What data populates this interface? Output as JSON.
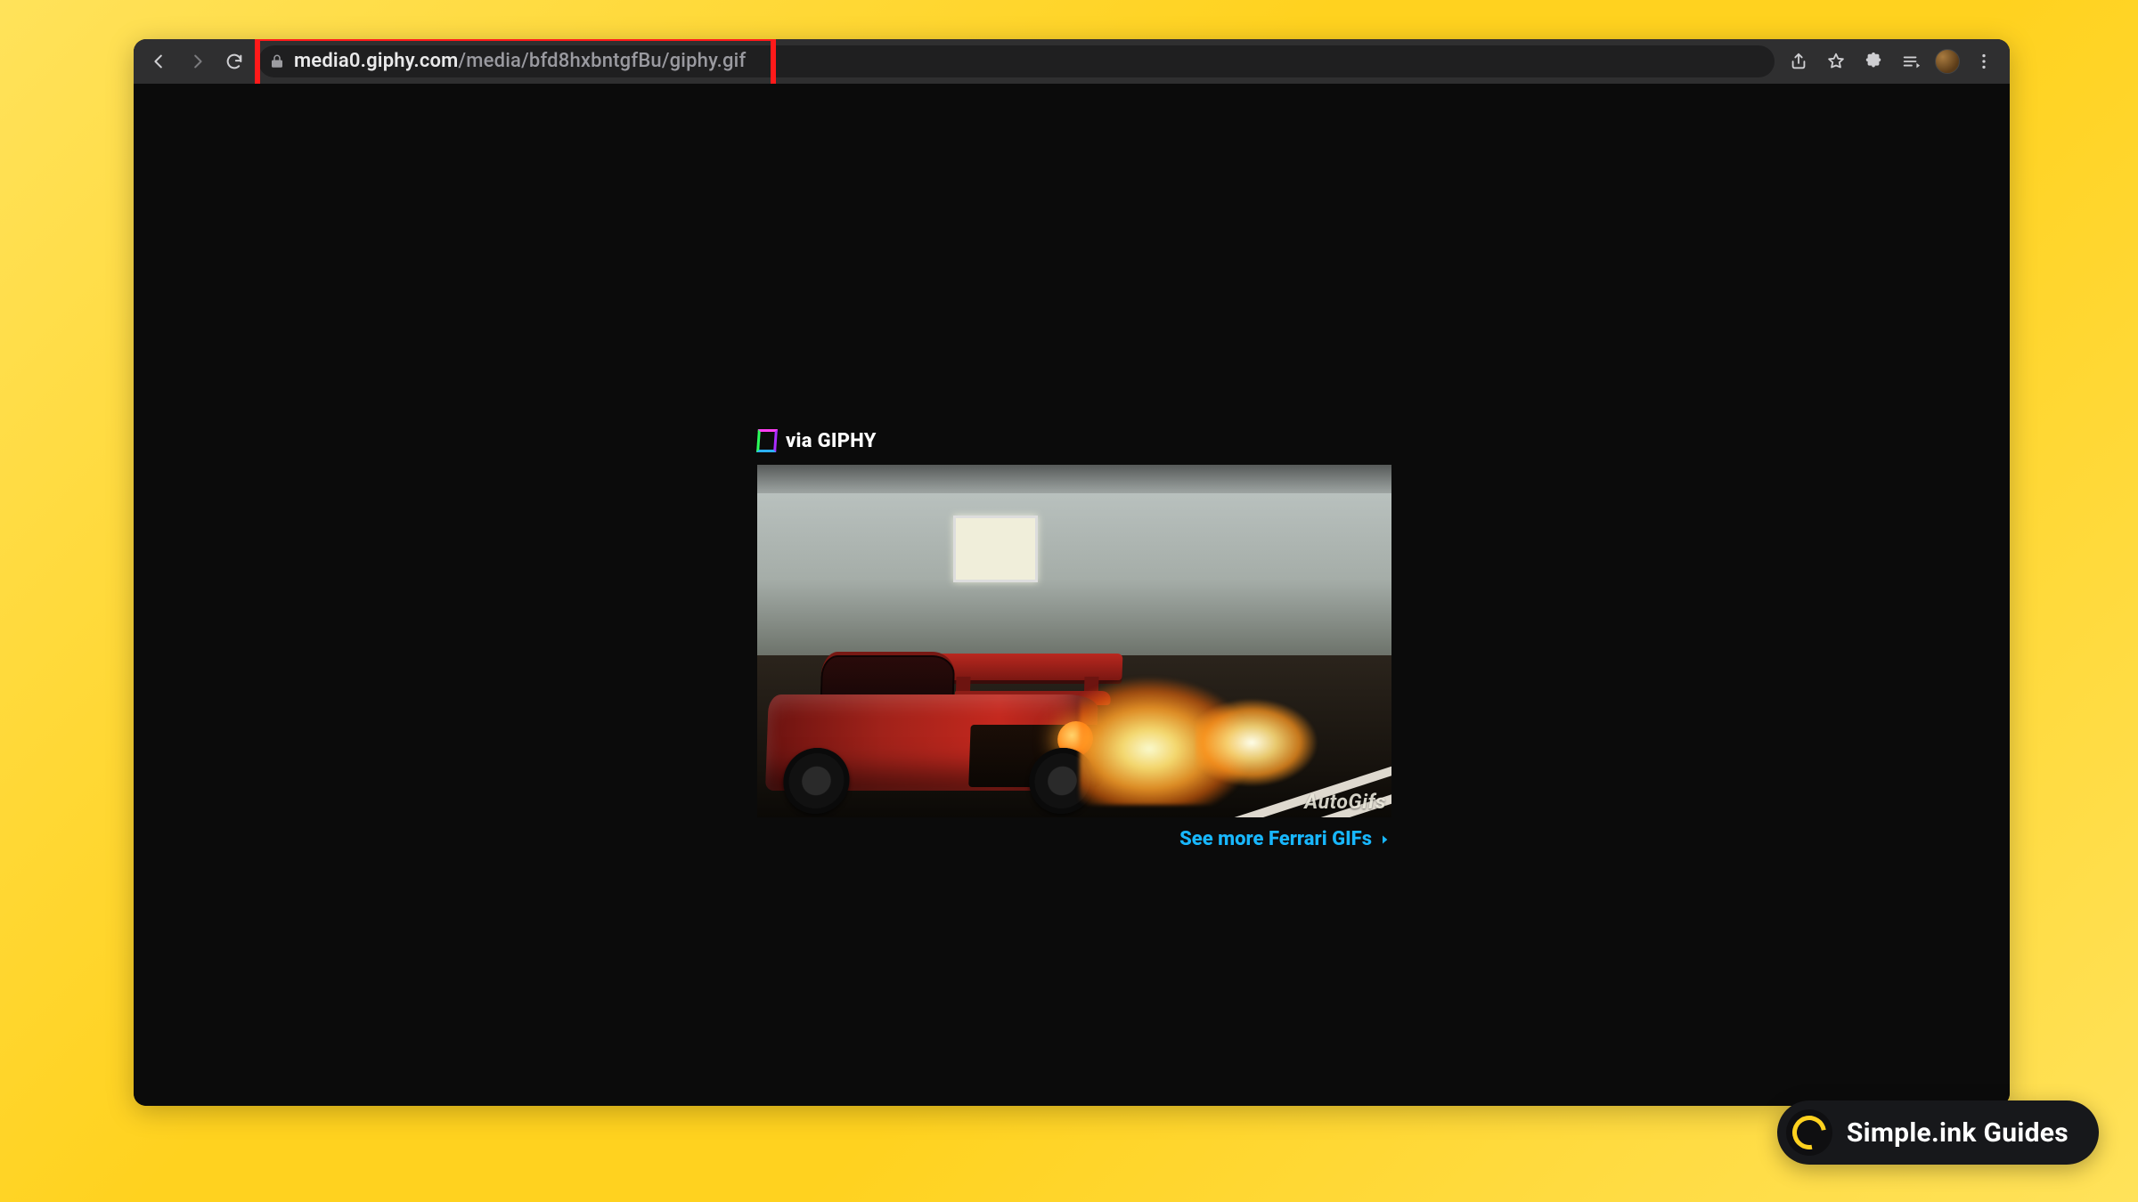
{
  "toolbar": {
    "url_domain": "media0.giphy.com",
    "url_path": "/media/bfd8hxbntgfBu/giphy.gif"
  },
  "highlight": {
    "target": "address-bar"
  },
  "content": {
    "via_label": "via GIPHY",
    "watermark": "AutoGifs",
    "more_link_label": "See more Ferrari GIFs"
  },
  "overlay": {
    "simpleink_label": "Simple.ink Guides"
  },
  "icons": {
    "back": "back-arrow",
    "forward": "forward-arrow",
    "reload": "reload",
    "lock": "lock",
    "share": "share",
    "star": "star",
    "extensions": "puzzle",
    "media": "media-controls",
    "avatar": "profile-avatar",
    "menu": "kebab-menu",
    "chevron_right": "chevron-right",
    "giphy": "giphy-logo",
    "simpleink": "simpleink-ring"
  }
}
